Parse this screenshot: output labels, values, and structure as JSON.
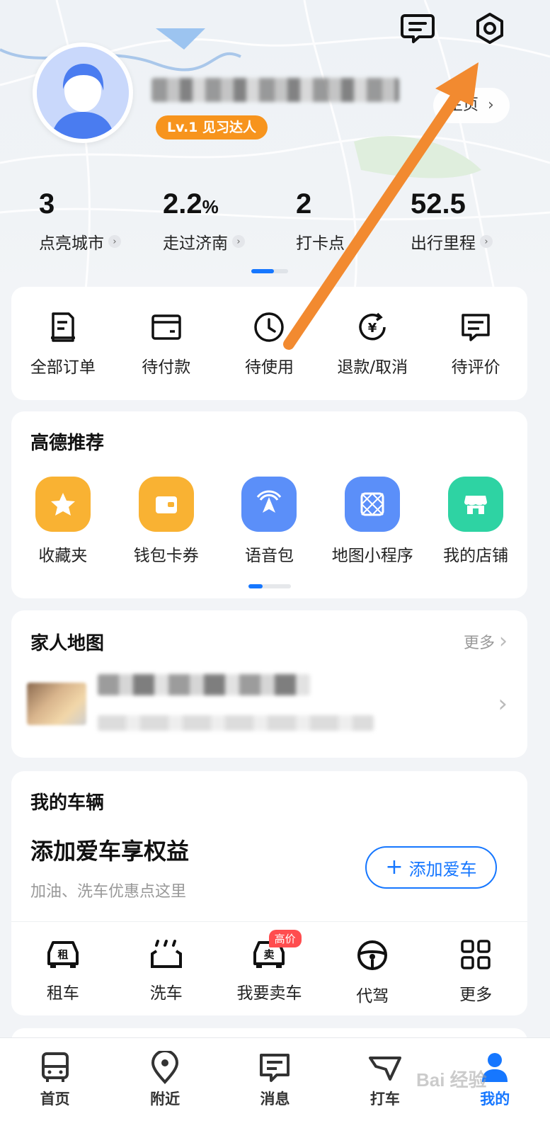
{
  "profile": {
    "level_badge": "Lv.1 见习达人",
    "homepage_label": "主页"
  },
  "stats": [
    {
      "value": "3",
      "unit": "",
      "label": "点亮城市"
    },
    {
      "value": "2.2",
      "unit": "%",
      "label": "走过济南"
    },
    {
      "value": "2",
      "unit": "",
      "label": "打卡点"
    },
    {
      "value": "52.5",
      "unit": "",
      "label": "出行里程"
    }
  ],
  "orders": [
    {
      "label": "全部订单",
      "icon": "receipt-icon"
    },
    {
      "label": "待付款",
      "icon": "wallet-icon"
    },
    {
      "label": "待使用",
      "icon": "clock-icon"
    },
    {
      "label": "退款/取消",
      "icon": "refund-icon"
    },
    {
      "label": "待评价",
      "icon": "comment-icon"
    }
  ],
  "recommend": {
    "title": "高德推荐",
    "items": [
      {
        "label": "收藏夹",
        "icon": "star-icon",
        "color": "#f9b233"
      },
      {
        "label": "钱包卡券",
        "icon": "wallet-card-icon",
        "color": "#f9b233"
      },
      {
        "label": "语音包",
        "icon": "voice-nav-icon",
        "color": "#5b8ff9"
      },
      {
        "label": "地图小程序",
        "icon": "mini-program-icon",
        "color": "#5b8ff9"
      },
      {
        "label": "我的店铺",
        "icon": "shop-icon",
        "color": "#2ed3a3"
      }
    ]
  },
  "family": {
    "title": "家人地图",
    "more_label": "更多"
  },
  "vehicle": {
    "title": "我的车辆",
    "headline": "添加爱车享权益",
    "subtitle": "加油、洗车优惠点这里",
    "add_button": "添加爱车",
    "services": [
      {
        "label": "租车",
        "icon": "rent-car-icon",
        "badge": ""
      },
      {
        "label": "洗车",
        "icon": "car-wash-icon",
        "badge": ""
      },
      {
        "label": "我要卖车",
        "icon": "sell-car-icon",
        "badge": "高价"
      },
      {
        "label": "代驾",
        "icon": "steering-wheel-icon",
        "badge": ""
      },
      {
        "label": "更多",
        "icon": "grid-more-icon",
        "badge": ""
      }
    ]
  },
  "nav": [
    {
      "label": "首页",
      "icon": "bus-icon"
    },
    {
      "label": "附近",
      "icon": "location-pin-icon"
    },
    {
      "label": "消息",
      "icon": "message-icon"
    },
    {
      "label": "打车",
      "icon": "taxi-icon"
    },
    {
      "label": "我的",
      "icon": "user-icon"
    }
  ],
  "accent_color": "#1677ff",
  "watermark": "Bai 经验"
}
